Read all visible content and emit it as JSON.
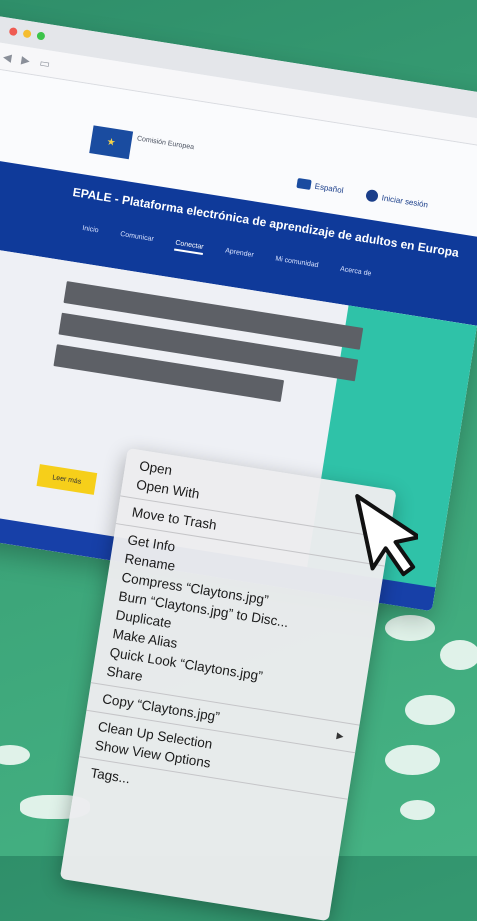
{
  "browser": {
    "site": {
      "eu_logo_text": "★",
      "eu_label": "Comisión Europea",
      "language": "Español",
      "user_label": "Iniciar sesión",
      "title": "EPALE - Plataforma electrónica de aprendizaje de adultos en Europa",
      "menu": [
        "Inicio",
        "Comunicar",
        "Conectar",
        "Aprender",
        "Mi comunidad",
        "Acerca de"
      ],
      "side_button": "‹",
      "cta_label": "Leer más"
    }
  },
  "context_menu": {
    "items": [
      {
        "label": "Open"
      },
      {
        "label": "Open With"
      },
      {
        "sep": true
      },
      {
        "label": "Move to Trash"
      },
      {
        "sep": true
      },
      {
        "label": "Get Info"
      },
      {
        "label": "Rename"
      },
      {
        "label": "Compress “Claytons.jpg”"
      },
      {
        "label": "Burn “Claytons.jpg” to Disc..."
      },
      {
        "label": "Duplicate"
      },
      {
        "label": "Make Alias"
      },
      {
        "label": "Quick Look “Claytons.jpg”"
      },
      {
        "label": "Share"
      },
      {
        "sep": true
      },
      {
        "label": "Copy “Claytons.jpg”",
        "submenu": true
      },
      {
        "sep": true
      },
      {
        "label": "Clean Up Selection"
      },
      {
        "label": "Show View Options"
      },
      {
        "sep": true
      },
      {
        "label": "Tags..."
      }
    ],
    "submenu_arrow": "▶"
  },
  "colors": {
    "background": "#3aa277",
    "site_header": "#0f3a9a",
    "teal_panel": "#2fc2a8",
    "cta": "#f6cf1a"
  }
}
